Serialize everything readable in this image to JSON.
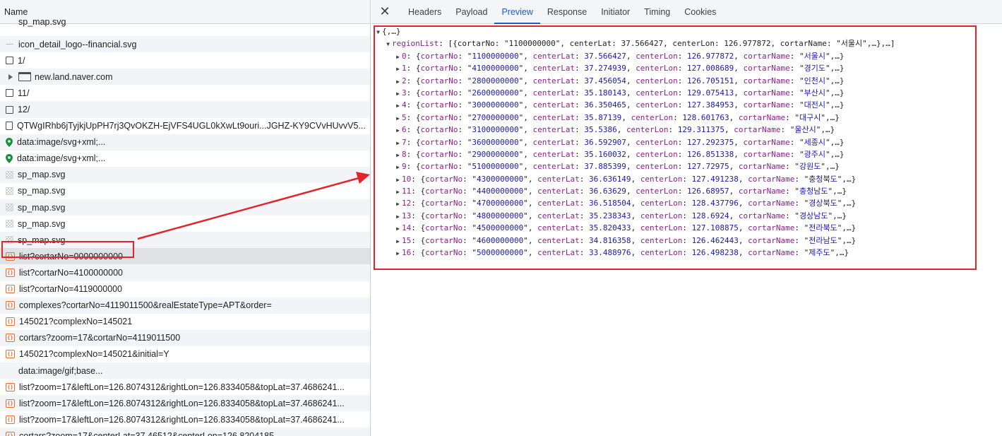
{
  "list": {
    "header": "Name",
    "rows": [
      {
        "icon": "none",
        "icon_name": "blank-icon",
        "text": "sp_map.svg",
        "cut": true
      },
      {
        "icon": "dash",
        "icon_name": "dash-icon",
        "text": "icon_detail_logo--financial.svg"
      },
      {
        "icon": "doc",
        "icon_name": "document-icon",
        "text": "1/"
      },
      {
        "icon": "window",
        "icon_name": "frame-window-icon",
        "text": "new.land.naver.com",
        "expandable": true
      },
      {
        "icon": "doc",
        "icon_name": "document-icon",
        "text": "11/"
      },
      {
        "icon": "doc",
        "icon_name": "document-icon",
        "text": "12/"
      },
      {
        "icon": "page",
        "icon_name": "file-icon",
        "text": "QTWgIRhb6jTyjkjUpPH7rj3QvOKZH-EjVFS4UGL0kXwLt9ouri...JGHZ-KY9CVvHUvvV5..."
      },
      {
        "icon": "pin",
        "icon_name": "map-pin-icon",
        "text": "data:image/svg+xml;..."
      },
      {
        "icon": "pin",
        "icon_name": "map-pin-icon",
        "text": "data:image/svg+xml;..."
      },
      {
        "icon": "svg",
        "icon_name": "svg-image-icon",
        "text": "sp_map.svg"
      },
      {
        "icon": "svg",
        "icon_name": "svg-image-icon",
        "text": "sp_map.svg"
      },
      {
        "icon": "svg",
        "icon_name": "svg-image-icon",
        "text": "sp_map.svg"
      },
      {
        "icon": "svg",
        "icon_name": "svg-image-icon",
        "text": "sp_map.svg"
      },
      {
        "icon": "svg",
        "icon_name": "svg-image-icon",
        "text": "sp_map.svg"
      },
      {
        "icon": "json",
        "icon_name": "json-icon",
        "text": "list?cortarNo=0000000000",
        "selected": true
      },
      {
        "icon": "json",
        "icon_name": "json-icon",
        "text": "list?cortarNo=4100000000"
      },
      {
        "icon": "json",
        "icon_name": "json-icon",
        "text": "list?cortarNo=4119000000"
      },
      {
        "icon": "json",
        "icon_name": "json-icon",
        "text": "complexes?cortarNo=4119011500&realEstateType=APT&order="
      },
      {
        "icon": "json",
        "icon_name": "json-icon",
        "text": "145021?complexNo=145021"
      },
      {
        "icon": "json",
        "icon_name": "json-icon",
        "text": "cortars?zoom=17&cortarNo=4119011500"
      },
      {
        "icon": "json",
        "icon_name": "json-icon",
        "text": "145021?complexNo=145021&initial=Y"
      },
      {
        "icon": "none",
        "icon_name": "blank-icon",
        "text": "data:image/gif;base..."
      },
      {
        "icon": "json",
        "icon_name": "json-icon",
        "text": "list?zoom=17&leftLon=126.8074312&rightLon=126.8334058&topLat=37.4686241..."
      },
      {
        "icon": "json",
        "icon_name": "json-icon",
        "text": "list?zoom=17&leftLon=126.8074312&rightLon=126.8334058&topLat=37.4686241..."
      },
      {
        "icon": "json",
        "icon_name": "json-icon",
        "text": "list?zoom=17&leftLon=126.8074312&rightLon=126.8334058&topLat=37.4686241..."
      },
      {
        "icon": "json",
        "icon_name": "json-icon",
        "text": "cortars?zoom=17&centerLat=37.46512&centerLon=126.8204185"
      }
    ]
  },
  "details": {
    "close_glyph": "✕",
    "tabs": [
      {
        "id": "headers",
        "label": "Headers",
        "active": false
      },
      {
        "id": "payload",
        "label": "Payload",
        "active": false
      },
      {
        "id": "preview",
        "label": "Preview",
        "active": true
      },
      {
        "id": "response",
        "label": "Response",
        "active": false
      },
      {
        "id": "initiator",
        "label": "Initiator",
        "active": false
      },
      {
        "id": "timing",
        "label": "Timing",
        "active": false
      },
      {
        "id": "cookies",
        "label": "Cookies",
        "active": false
      }
    ]
  },
  "preview": {
    "root_summary": "{,…}",
    "regionList_key": "regionList",
    "regionList_summary_head": "[{cortarNo: \"1100000000\", centerLat: 37.566427, centerLon: 126.977872, cortarName: \"서울시\",…},…]",
    "items": [
      {
        "index": "0",
        "cortarNo": "1100000000",
        "centerLat": "37.566427",
        "centerLon": "126.977872",
        "cortarName": "서울시"
      },
      {
        "index": "1",
        "cortarNo": "4100000000",
        "centerLat": "37.274939",
        "centerLon": "127.008689",
        "cortarName": "경기도"
      },
      {
        "index": "2",
        "cortarNo": "2800000000",
        "centerLat": "37.456054",
        "centerLon": "126.705151",
        "cortarName": "인천시"
      },
      {
        "index": "3",
        "cortarNo": "2600000000",
        "centerLat": "35.180143",
        "centerLon": "129.075413",
        "cortarName": "부산시"
      },
      {
        "index": "4",
        "cortarNo": "3000000000",
        "centerLat": "36.350465",
        "centerLon": "127.384953",
        "cortarName": "대전시"
      },
      {
        "index": "5",
        "cortarNo": "2700000000",
        "centerLat": "35.87139",
        "centerLon": "128.601763",
        "cortarName": "대구시"
      },
      {
        "index": "6",
        "cortarNo": "3100000000",
        "centerLat": "35.5386",
        "centerLon": "129.311375",
        "cortarName": "울산시"
      },
      {
        "index": "7",
        "cortarNo": "3600000000",
        "centerLat": "36.592907",
        "centerLon": "127.292375",
        "cortarName": "세종시"
      },
      {
        "index": "8",
        "cortarNo": "2900000000",
        "centerLat": "35.160032",
        "centerLon": "126.851338",
        "cortarName": "광주시"
      },
      {
        "index": "9",
        "cortarNo": "5100000000",
        "centerLat": "37.885399",
        "centerLon": "127.72975",
        "cortarName": "강원도"
      },
      {
        "index": "10",
        "cortarNo": "4300000000",
        "centerLat": "36.636149",
        "centerLon": "127.491238",
        "cortarName": "충청북도"
      },
      {
        "index": "11",
        "cortarNo": "4400000000",
        "centerLat": "36.63629",
        "centerLon": "126.68957",
        "cortarName": "충청남도"
      },
      {
        "index": "12",
        "cortarNo": "4700000000",
        "centerLat": "36.518504",
        "centerLon": "128.437796",
        "cortarName": "경상북도"
      },
      {
        "index": "13",
        "cortarNo": "4800000000",
        "centerLat": "35.238343",
        "centerLon": "128.6924",
        "cortarName": "경상남도"
      },
      {
        "index": "14",
        "cortarNo": "4500000000",
        "centerLat": "35.820433",
        "centerLon": "127.108875",
        "cortarName": "전라북도"
      },
      {
        "index": "15",
        "cortarNo": "4600000000",
        "centerLat": "34.816358",
        "centerLon": "126.462443",
        "cortarName": "전라남도"
      },
      {
        "index": "16",
        "cortarNo": "5000000000",
        "centerLat": "33.488976",
        "centerLon": "126.498238",
        "cortarName": "제주도"
      }
    ]
  },
  "colors": {
    "annotation_red": "#e0262c",
    "active_tab_blue": "#1a5dc9",
    "json_icon_orange": "#e6702e",
    "key_purple": "#8c1f8c",
    "value_blue": "#1a1aa6"
  }
}
